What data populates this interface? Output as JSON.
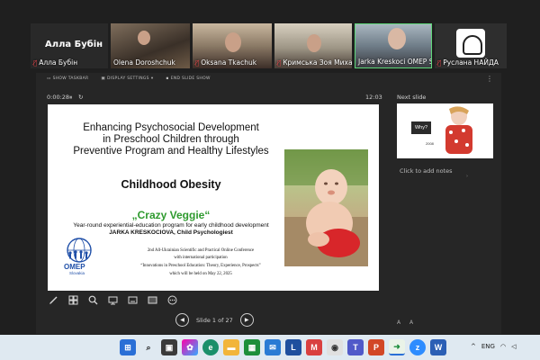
{
  "participants": [
    {
      "name": "Алла Бубін",
      "label": "Алла Бубін",
      "muted": true,
      "type": "speaker"
    },
    {
      "name": "Olena Doroshchuk",
      "muted": false
    },
    {
      "name": "Oksana Tkachuk",
      "muted": true
    },
    {
      "name": "Кримська Зоя Михай...",
      "muted": true
    },
    {
      "name": "Jarka Kreskoci OMEP Slov...",
      "muted": false,
      "active": true
    },
    {
      "name": "Руслана НАЙДА",
      "muted": true
    }
  ],
  "presenter": {
    "toolbar": [
      "SHOW TASKBAR",
      "DISPLAY SETTINGS",
      "END SLIDE SHOW"
    ],
    "timer": "0:00:28",
    "clock": "12:03",
    "next_slide_label": "Next slide",
    "notes_placeholder": "Click to add notes",
    "slide_counter": "Slide 1 of 27"
  },
  "slide": {
    "title_line1": "Enhancing Psychosocial Development",
    "title_line2": "in Preschool Children through",
    "title_line3": "Preventive Program and Healthy Lifestyles",
    "subtitle": "Childhood Obesity",
    "program_name": "„Crazy Veggie“",
    "program_desc": "Year-round experiential-education program for early childhood development",
    "author": "JARKA KRESKOCIOVA, Child Psychologiest",
    "conf_line1": "2nd All-Ukrainian Scientific and Practical Online Conference",
    "conf_line2": "with international participation",
    "conf_line3": "“Innovations in Preschool Education: Theory, Experience, Prospects”",
    "conf_line4": "which will be held on May 22, 2025",
    "logo_text": "OMEP",
    "logo_sub": "Slovakia"
  },
  "next_slide": {
    "why": "Why?",
    "year": "2008"
  },
  "taskbar": {
    "language": "ENG"
  }
}
